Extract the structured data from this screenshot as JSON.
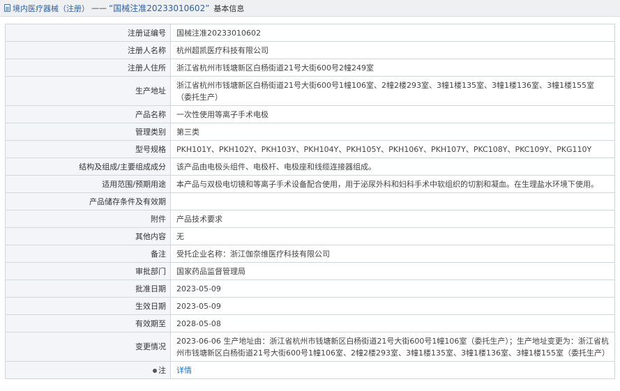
{
  "header": {
    "breadcrumb_link": "境内医疗器械（注册）",
    "separator": "——",
    "record_title": "“国械注准20233010602”",
    "suffix": "基本信息"
  },
  "rows": [
    {
      "label": "注册证编号",
      "value": "国械注准20233010602",
      "h": 25
    },
    {
      "label": "注册人名称",
      "value": "杭州超凯医疗科技有限公司",
      "h": 25
    },
    {
      "label": "注册人住所",
      "value": "浙江省杭州市钱塘新区白杨街道21号大街600号2幢249室",
      "h": 25
    },
    {
      "label": "生产地址",
      "value": "浙江省杭州市钱塘新区白杨街道21号大街600号1幢106室、2幢2楼293室、3幢1楼135室、3幢1楼136室、3幢1楼155室（委托生产）",
      "h": 42
    },
    {
      "label": "产品名称",
      "value": "一次性使用等离子手术电极",
      "h": 25
    },
    {
      "label": "管理类别",
      "value": "第三类",
      "h": 25
    },
    {
      "label": "型号规格",
      "value": "PKH101Y、PKH102Y、PKH103Y、PKH104Y、PKH105Y、PKH106Y、PKH107Y、PKC108Y、PKC109Y、PKG110Y",
      "h": 25
    },
    {
      "label": "结构及组成/主要组成成分",
      "value": "该产品由电极头组件、电极杆、电极座和线缆连接器组成。",
      "h": 25
    },
    {
      "label": "适用范围/预期用途",
      "value": "本产品与双极电切镜和等离子手术设备配合使用，用于泌尿外科和妇科手术中软组织的切割和凝血。在生理盐水环境下使用。",
      "h": 25
    },
    {
      "label": "产品储存条件及有效期",
      "value": "",
      "h": 25
    },
    {
      "label": "附件",
      "value": "产品技术要求",
      "h": 25
    },
    {
      "label": "其他内容",
      "value": "无",
      "h": 25
    },
    {
      "label": "备注",
      "value": "受托企业名称：浙江伽奈维医疗科技有限公司",
      "h": 25
    },
    {
      "label": "审批部门",
      "value": "国家药品监督管理局",
      "h": 25
    },
    {
      "label": "批准日期",
      "value": "2023-05-09",
      "h": 25
    },
    {
      "label": "生效日期",
      "value": "2023-05-09",
      "h": 25
    },
    {
      "label": "有效期至",
      "value": "2028-05-08",
      "h": 25
    },
    {
      "label": "变更情况",
      "value": "2023-06-06 生产地址由：浙江省杭州市钱塘新区白杨街道21号大街600号1幢106室（委托生产）；生产地址变更为：浙江省杭州市钱塘新区白杨街道21号大街600号1幢106室、2幢2楼293室、3幢1楼135室、3幢1楼136室、3幢1楼155室（委托生产）",
      "h": 42
    }
  ],
  "note_row": {
    "label": "注",
    "link_text": "详情"
  }
}
